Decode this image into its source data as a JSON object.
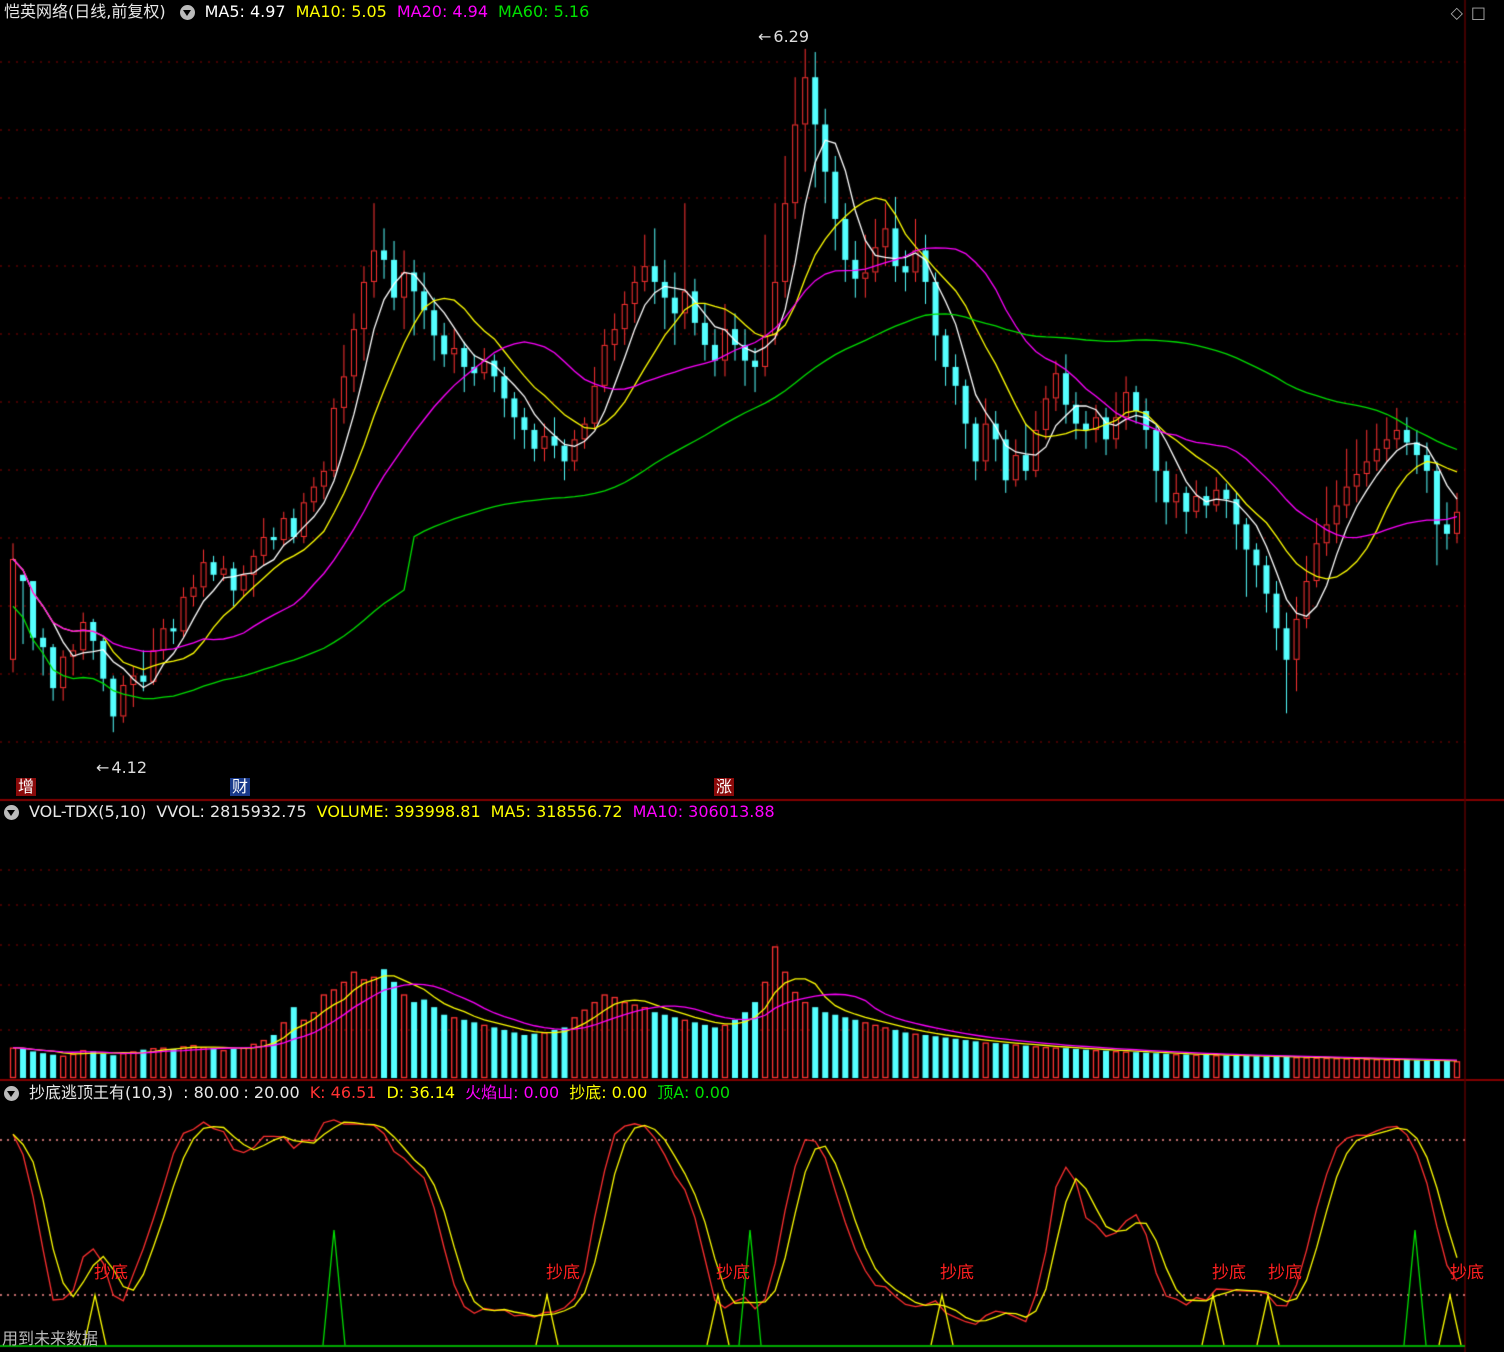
{
  "header": {
    "stock_title": "恺英网络(日线,前复权)",
    "ma5": "MA5: 4.97",
    "ma10": "MA10: 5.05",
    "ma20": "MA20: 4.94",
    "ma60": "MA60: 5.16",
    "icons": [
      "diamond-icon",
      "square-icon"
    ],
    "high_label": "6.29",
    "low_label": "4.12"
  },
  "event_tags": [
    {
      "text": "增",
      "style": "red"
    },
    {
      "text": "财",
      "style": "blue"
    },
    {
      "text": "涨",
      "style": "red"
    }
  ],
  "volume_panel": {
    "name": "VOL-TDX(5,10)",
    "vvol": "VVOL: 2815932.75",
    "volume": "VOLUME: 393998.81",
    "ma5": "MA5: 318556.72",
    "ma10": "MA10: 306013.88"
  },
  "indicator_panel": {
    "name": "抄底逃顶王有(10,3)",
    "level_high": ": 80.00",
    "level_low": ": 20.00",
    "k": "K: 46.51",
    "d": "D: 36.14",
    "flame": "火焰山: 0.00",
    "bottom": "抄底: 0.00",
    "top": "顶A: 0.00",
    "signal_text": "抄底"
  },
  "footer": "用到未来数据",
  "colors": {
    "up": "#ff3232",
    "down": "#54ffff",
    "ma5": "#ffffff",
    "ma10": "#ffff00",
    "ma20": "#ff00ff",
    "ma60": "#00e000",
    "grid": "#8a0000",
    "separator": "#b00000"
  },
  "chart_data": {
    "type": "candlestick",
    "price_scale": [
      4.0,
      6.35
    ],
    "candles": [
      [
        4.35,
        4.67,
        4.31,
        4.72
      ],
      [
        4.62,
        4.6,
        4.4,
        4.62
      ],
      [
        4.6,
        4.42,
        4.38,
        4.6
      ],
      [
        4.42,
        4.39,
        4.3,
        4.45
      ],
      [
        4.39,
        4.26,
        4.22,
        4.4
      ],
      [
        4.26,
        4.36,
        4.22,
        4.38
      ],
      [
        4.36,
        4.38,
        4.3,
        4.4
      ],
      [
        4.38,
        4.47,
        4.35,
        4.5
      ],
      [
        4.47,
        4.41,
        4.35,
        4.48
      ],
      [
        4.41,
        4.29,
        4.25,
        4.42
      ],
      [
        4.29,
        4.17,
        4.12,
        4.3
      ],
      [
        4.17,
        4.27,
        4.15,
        4.3
      ],
      [
        4.27,
        4.3,
        4.2,
        4.33
      ],
      [
        4.3,
        4.28,
        4.25,
        4.38
      ],
      [
        4.28,
        4.38,
        4.27,
        4.45
      ],
      [
        4.38,
        4.45,
        4.35,
        4.48
      ],
      [
        4.45,
        4.44,
        4.4,
        4.48
      ],
      [
        4.44,
        4.55,
        4.42,
        4.58
      ],
      [
        4.55,
        4.58,
        4.52,
        4.62
      ],
      [
        4.58,
        4.66,
        4.55,
        4.7
      ],
      [
        4.66,
        4.62,
        4.6,
        4.68
      ],
      [
        4.62,
        4.64,
        4.6,
        4.68
      ],
      [
        4.64,
        4.57,
        4.52,
        4.66
      ],
      [
        4.57,
        4.62,
        4.55,
        4.65
      ],
      [
        4.62,
        4.68,
        4.55,
        4.7
      ],
      [
        4.68,
        4.74,
        4.65,
        4.8
      ],
      [
        4.74,
        4.73,
        4.7,
        4.77
      ],
      [
        4.73,
        4.8,
        4.71,
        4.82
      ],
      [
        4.8,
        4.74,
        4.72,
        4.83
      ],
      [
        4.74,
        4.85,
        4.72,
        4.88
      ],
      [
        4.85,
        4.9,
        4.82,
        4.93
      ],
      [
        4.9,
        4.95,
        4.86,
        4.98
      ],
      [
        4.95,
        5.15,
        4.93,
        5.18
      ],
      [
        5.15,
        5.25,
        5.1,
        5.35
      ],
      [
        5.25,
        5.4,
        5.2,
        5.45
      ],
      [
        5.4,
        5.55,
        5.3,
        5.6
      ],
      [
        5.55,
        5.65,
        5.5,
        5.8
      ],
      [
        5.65,
        5.62,
        5.56,
        5.72
      ],
      [
        5.62,
        5.5,
        5.46,
        5.68
      ],
      [
        5.5,
        5.58,
        5.4,
        5.65
      ],
      [
        5.58,
        5.52,
        5.38,
        5.62
      ],
      [
        5.52,
        5.46,
        5.4,
        5.58
      ],
      [
        5.46,
        5.38,
        5.3,
        5.5
      ],
      [
        5.38,
        5.32,
        5.28,
        5.42
      ],
      [
        5.32,
        5.34,
        5.26,
        5.4
      ],
      [
        5.34,
        5.28,
        5.2,
        5.36
      ],
      [
        5.28,
        5.26,
        5.22,
        5.32
      ],
      [
        5.26,
        5.3,
        5.24,
        5.34
      ],
      [
        5.3,
        5.25,
        5.2,
        5.32
      ],
      [
        5.25,
        5.18,
        5.12,
        5.28
      ],
      [
        5.18,
        5.12,
        5.05,
        5.2
      ],
      [
        5.12,
        5.08,
        5.02,
        5.15
      ],
      [
        5.08,
        5.02,
        4.98,
        5.1
      ],
      [
        5.02,
        5.06,
        4.98,
        5.1
      ],
      [
        5.06,
        5.03,
        4.99,
        5.12
      ],
      [
        5.03,
        4.98,
        4.92,
        5.05
      ],
      [
        4.98,
        5.05,
        4.95,
        5.08
      ],
      [
        5.05,
        5.1,
        5.02,
        5.12
      ],
      [
        5.1,
        5.22,
        5.08,
        5.28
      ],
      [
        5.22,
        5.35,
        5.2,
        5.4
      ],
      [
        5.35,
        5.4,
        5.3,
        5.45
      ],
      [
        5.4,
        5.48,
        5.35,
        5.52
      ],
      [
        5.48,
        5.55,
        5.42,
        5.6
      ],
      [
        5.55,
        5.6,
        5.52,
        5.7
      ],
      [
        5.6,
        5.55,
        5.48,
        5.72
      ],
      [
        5.55,
        5.5,
        5.4,
        5.62
      ],
      [
        5.5,
        5.45,
        5.35,
        5.58
      ],
      [
        5.45,
        5.52,
        5.4,
        5.8
      ],
      [
        5.52,
        5.42,
        5.38,
        5.56
      ],
      [
        5.42,
        5.35,
        5.3,
        5.48
      ],
      [
        5.35,
        5.3,
        5.25,
        5.4
      ],
      [
        5.3,
        5.4,
        5.25,
        5.48
      ],
      [
        5.4,
        5.35,
        5.3,
        5.45
      ],
      [
        5.35,
        5.3,
        5.22,
        5.4
      ],
      [
        5.3,
        5.28,
        5.2,
        5.34
      ],
      [
        5.28,
        5.38,
        5.25,
        5.7
      ],
      [
        5.38,
        5.55,
        5.35,
        5.8
      ],
      [
        5.55,
        5.8,
        5.5,
        5.95
      ],
      [
        5.8,
        6.05,
        5.75,
        6.2
      ],
      [
        6.05,
        6.2,
        5.9,
        6.29
      ],
      [
        6.2,
        6.05,
        5.85,
        6.28
      ],
      [
        6.05,
        5.9,
        5.8,
        6.1
      ],
      [
        5.9,
        5.75,
        5.65,
        5.95
      ],
      [
        5.75,
        5.62,
        5.55,
        5.8
      ],
      [
        5.62,
        5.56,
        5.5,
        5.68
      ],
      [
        5.56,
        5.58,
        5.5,
        5.7
      ],
      [
        5.58,
        5.66,
        5.55,
        5.75
      ],
      [
        5.66,
        5.72,
        5.6,
        5.8
      ],
      [
        5.72,
        5.6,
        5.55,
        5.82
      ],
      [
        5.6,
        5.58,
        5.52,
        5.65
      ],
      [
        5.58,
        5.65,
        5.55,
        5.75
      ],
      [
        5.65,
        5.55,
        5.48,
        5.7
      ],
      [
        5.55,
        5.38,
        5.3,
        5.58
      ],
      [
        5.38,
        5.28,
        5.22,
        5.4
      ],
      [
        5.28,
        5.22,
        5.16,
        5.32
      ],
      [
        5.22,
        5.1,
        5.02,
        5.24
      ],
      [
        5.1,
        4.98,
        4.92,
        5.12
      ],
      [
        4.98,
        5.1,
        4.95,
        5.18
      ],
      [
        5.1,
        5.05,
        4.98,
        5.14
      ],
      [
        5.05,
        4.92,
        4.88,
        5.08
      ],
      [
        4.92,
        5.0,
        4.9,
        5.05
      ],
      [
        5.0,
        4.95,
        4.92,
        5.1
      ],
      [
        4.95,
        5.08,
        4.93,
        5.14
      ],
      [
        5.08,
        5.18,
        5.05,
        5.22
      ],
      [
        5.18,
        5.26,
        5.14,
        5.3
      ],
      [
        5.26,
        5.16,
        5.1,
        5.32
      ],
      [
        5.16,
        5.1,
        5.05,
        5.2
      ],
      [
        5.1,
        5.08,
        5.02,
        5.14
      ],
      [
        5.08,
        5.12,
        5.04,
        5.16
      ],
      [
        5.12,
        5.05,
        5.0,
        5.15
      ],
      [
        5.05,
        5.12,
        5.02,
        5.2
      ],
      [
        5.12,
        5.2,
        5.08,
        5.25
      ],
      [
        5.2,
        5.14,
        5.1,
        5.22
      ],
      [
        5.14,
        5.08,
        5.02,
        5.18
      ],
      [
        5.08,
        4.95,
        4.85,
        5.1
      ],
      [
        4.95,
        4.85,
        4.78,
        4.98
      ],
      [
        4.85,
        4.88,
        4.8,
        4.94
      ],
      [
        4.88,
        4.82,
        4.75,
        4.9
      ],
      [
        4.82,
        4.87,
        4.8,
        4.92
      ],
      [
        4.87,
        4.84,
        4.8,
        4.9
      ],
      [
        4.84,
        4.89,
        4.82,
        4.93
      ],
      [
        4.89,
        4.86,
        4.8,
        4.91
      ],
      [
        4.86,
        4.78,
        4.7,
        4.88
      ],
      [
        4.78,
        4.7,
        4.55,
        4.8
      ],
      [
        4.7,
        4.65,
        4.58,
        4.72
      ],
      [
        4.65,
        4.56,
        4.5,
        4.68
      ],
      [
        4.56,
        4.45,
        4.38,
        4.6
      ],
      [
        4.45,
        4.35,
        4.18,
        4.5
      ],
      [
        4.35,
        4.48,
        4.25,
        4.55
      ],
      [
        4.48,
        4.6,
        4.45,
        4.68
      ],
      [
        4.6,
        4.72,
        4.58,
        4.8
      ],
      [
        4.72,
        4.78,
        4.68,
        4.9
      ],
      [
        4.78,
        4.84,
        4.72,
        4.92
      ],
      [
        4.84,
        4.9,
        4.8,
        5.02
      ],
      [
        4.9,
        4.94,
        4.85,
        5.05
      ],
      [
        4.94,
        4.98,
        4.9,
        5.08
      ],
      [
        4.98,
        5.02,
        4.95,
        5.1
      ],
      [
        5.02,
        5.05,
        4.98,
        5.12
      ],
      [
        5.05,
        5.08,
        5.02,
        5.15
      ],
      [
        5.08,
        5.04,
        5.0,
        5.12
      ],
      [
        5.04,
        5.0,
        4.94,
        5.08
      ],
      [
        5.0,
        4.95,
        4.88,
        5.04
      ],
      [
        4.95,
        4.78,
        4.65,
        4.98
      ],
      [
        4.78,
        4.75,
        4.7,
        4.85
      ],
      [
        4.75,
        4.82,
        4.72,
        4.88
      ]
    ],
    "volume_scale": [
      0,
      1000000
    ],
    "volumes": [
      120000,
      115000,
      105000,
      98000,
      92000,
      88000,
      95000,
      110000,
      105000,
      96000,
      90000,
      98000,
      105000,
      112000,
      118000,
      120000,
      115000,
      125000,
      130000,
      122000,
      118000,
      110000,
      115000,
      120000,
      135000,
      150000,
      170000,
      220000,
      280000,
      230000,
      260000,
      330000,
      350000,
      380000,
      420000,
      390000,
      400000,
      430000,
      380000,
      330000,
      300000,
      310000,
      280000,
      250000,
      240000,
      230000,
      220000,
      210000,
      200000,
      190000,
      180000,
      170000,
      175000,
      180000,
      190000,
      200000,
      240000,
      270000,
      300000,
      330000,
      320000,
      300000,
      290000,
      280000,
      260000,
      250000,
      240000,
      230000,
      220000,
      210000,
      200000,
      210000,
      230000,
      260000,
      300000,
      380000,
      520000,
      420000,
      340000,
      300000,
      280000,
      260000,
      250000,
      240000,
      230000,
      220000,
      210000,
      200000,
      190000,
      180000,
      175000,
      170000,
      165000,
      160000,
      155000,
      150000,
      145000,
      140000,
      138000,
      135000,
      132000,
      128000,
      125000,
      122000,
      120000,
      118000,
      115000,
      112000,
      110000,
      108000,
      106000,
      104000,
      102000,
      100000,
      98000,
      96000,
      94000,
      93000,
      92000,
      91000,
      90000,
      89000,
      88000,
      87000,
      86000,
      85000,
      84000,
      83000,
      82000,
      81000,
      80000,
      79000,
      78000,
      77000,
      76000,
      75000,
      74000,
      73000,
      72000,
      71000,
      70000,
      69000,
      68000,
      67000,
      66000,
      65000,
      64000,
      63000,
      62000,
      61000
    ]
  }
}
